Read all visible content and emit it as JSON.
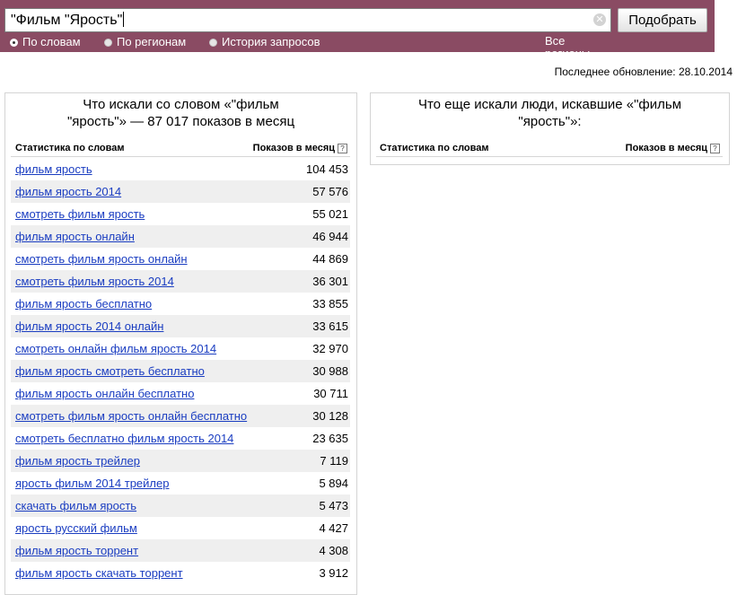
{
  "search": {
    "query": "\"Фильм \"Ярость\"",
    "submit_label": "Подобрать",
    "modes": [
      {
        "label": "По словам",
        "selected": true
      },
      {
        "label": "По регионам",
        "selected": false
      },
      {
        "label": "История запросов",
        "selected": false
      }
    ],
    "all_regions_label": "Все регионы"
  },
  "updated_text": "Последнее обновление: 28.10.2014",
  "left_panel": {
    "title_line1": "Что искали со словом «\"фильм",
    "title_line2": "\"ярость\"» — 87 017 показов в месяц",
    "col_words": "Статистика по словам",
    "col_count": "Показов в месяц",
    "help_glyph": "?",
    "rows": [
      {
        "keyword": "фильм ярость",
        "count": "104 453"
      },
      {
        "keyword": "фильм ярость 2014",
        "count": "57 576"
      },
      {
        "keyword": "смотреть фильм ярость",
        "count": "55 021"
      },
      {
        "keyword": "фильм ярость онлайн",
        "count": "46 944"
      },
      {
        "keyword": "смотреть фильм ярость онлайн",
        "count": "44 869"
      },
      {
        "keyword": "смотреть фильм ярость 2014",
        "count": "36 301"
      },
      {
        "keyword": "фильм ярость бесплатно",
        "count": "33 855"
      },
      {
        "keyword": "фильм ярость 2014 онлайн",
        "count": "33 615"
      },
      {
        "keyword": "смотреть онлайн фильм ярость 2014",
        "count": "32 970"
      },
      {
        "keyword": "фильм ярость смотреть бесплатно",
        "count": "30 988"
      },
      {
        "keyword": "фильм ярость онлайн бесплатно",
        "count": "30 711"
      },
      {
        "keyword": "смотреть фильм ярость онлайн бесплатно",
        "count": "30 128"
      },
      {
        "keyword": "смотреть бесплатно фильм ярость 2014",
        "count": "23 635"
      },
      {
        "keyword": "фильм ярость трейлер",
        "count": "7 119"
      },
      {
        "keyword": "ярость фильм 2014 трейлер",
        "count": "5 894"
      },
      {
        "keyword": "скачать фильм ярость",
        "count": "5 473"
      },
      {
        "keyword": "ярость русский фильм",
        "count": "4 427"
      },
      {
        "keyword": "фильм ярость торрент",
        "count": "4 308"
      },
      {
        "keyword": "фильм ярость скачать торрент",
        "count": "3 912"
      }
    ]
  },
  "right_panel": {
    "title_line1": "Что еще искали люди, искавшие «\"фильм",
    "title_line2": "\"ярость\"»:",
    "col_words": "Статистика по словам",
    "col_count": "Показов в месяц",
    "help_glyph": "?"
  },
  "colors": {
    "band": "#8a4b63",
    "link": "#1a3dc1",
    "row_alt": "#efefef"
  }
}
